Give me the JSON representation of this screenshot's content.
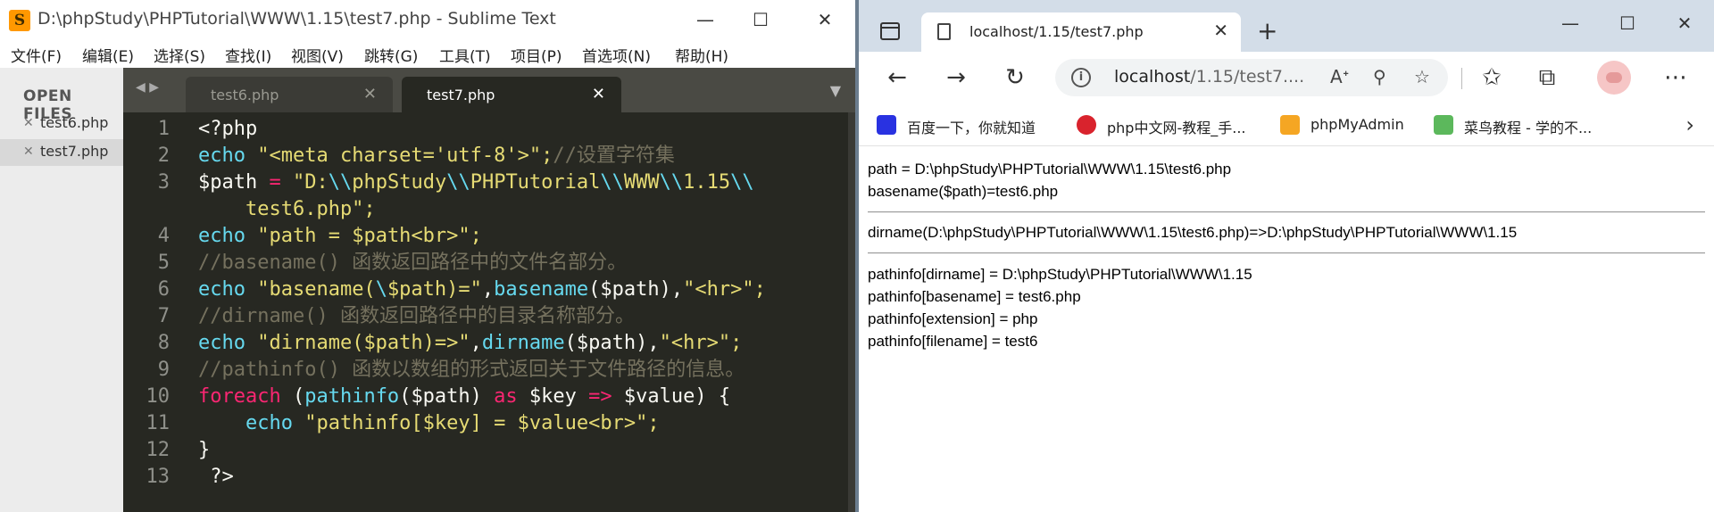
{
  "sublime": {
    "title": "D:\\phpStudy\\PHPTutorial\\WWW\\1.15\\test7.php - Sublime Text",
    "menu": [
      "文件(F)",
      "编辑(E)",
      "选择(S)",
      "查找(I)",
      "视图(V)",
      "跳转(G)",
      "工具(T)",
      "项目(P)",
      "首选项(N)",
      "帮助(H)"
    ],
    "sidebar": {
      "heading": "OPEN FILES",
      "files": [
        "test6.php",
        "test7.php"
      ]
    },
    "tabs": [
      "test6.php",
      "test7.php"
    ],
    "line_numbers": [
      "1",
      "2",
      "3",
      "",
      "4",
      "5",
      "6",
      "7",
      "8",
      "9",
      "10",
      "11",
      "12",
      "13"
    ],
    "code": {
      "l1": [
        "<?php"
      ],
      "l2": [
        "echo",
        " \"<meta charset='utf-8'>\";",
        "//设置字符集"
      ],
      "l3": [
        "$path",
        " = ",
        "\"D:",
        "\\\\",
        "phpStudy",
        "\\\\",
        "PHPTutorial",
        "\\\\",
        "WWW",
        "\\\\",
        "1.15",
        "\\\\"
      ],
      "l3b": [
        "    test6.php\";"
      ],
      "l4": [
        "echo",
        " \"path = ",
        "$path",
        "<br>\";"
      ],
      "l5": [
        "//basename() 函数返回路径中的文件名部分。"
      ],
      "l6": [
        "echo",
        " \"basename(",
        "\\",
        "$path)=\"",
        ",",
        "basename",
        "(",
        "$path",
        "),",
        "\"<hr>\";"
      ],
      "l7": [
        "//dirname() 函数返回路径中的目录名称部分。"
      ],
      "l8": [
        "echo",
        " \"dirname(",
        "$path",
        ")=>\"",
        ",",
        "dirname",
        "(",
        "$path",
        "),",
        "\"<hr>\";"
      ],
      "l9": [
        "//pathinfo() 函数以数组的形式返回关于文件路径的信息。"
      ],
      "l10": [
        "foreach",
        " (",
        "pathinfo",
        "(",
        "$path",
        ") ",
        "as",
        " ",
        "$key",
        " ",
        "=>",
        " ",
        "$value",
        ") {"
      ],
      "l11": [
        "    ",
        "echo",
        " \"pathinfo[",
        "$key",
        "] = ",
        "$value",
        "<br>\";"
      ],
      "l12": [
        "}"
      ],
      "l13": [
        " ?>"
      ]
    }
  },
  "edge": {
    "tab_title": "localhost/1.15/test7.php",
    "address": {
      "host": "localhost",
      "path": "/1.15/test7...."
    },
    "bookmarks": [
      "百度一下，你就知道",
      "php中文网-教程_手...",
      "phpMyAdmin",
      "菜鸟教程 - 学的不..."
    ],
    "bookmark_colors": [
      "#2932e1",
      "#d9232d",
      "#f5a623",
      "#5cb85c"
    ],
    "output": {
      "path_line": "path = D:\\phpStudy\\PHPTutorial\\WWW\\1.15\\test6.php",
      "basename_line": "basename($path)=test6.php",
      "dirname_line": "dirname(D:\\phpStudy\\PHPTutorial\\WWW\\1.15\\test6.php)=>D:\\phpStudy\\PHPTutorial\\WWW\\1.15",
      "pathinfo_lines": [
        "pathinfo[dirname] = D:\\phpStudy\\PHPTutorial\\WWW\\1.15",
        "pathinfo[basename] = test6.php",
        "pathinfo[extension] = php",
        "pathinfo[filename] = test6"
      ]
    }
  }
}
